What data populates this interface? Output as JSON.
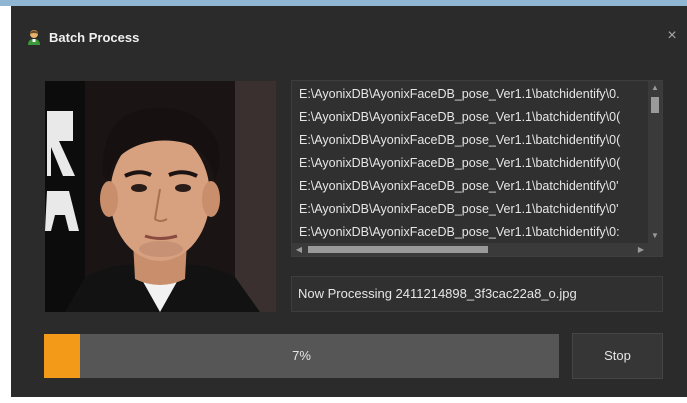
{
  "window": {
    "title": "Batch Process",
    "close_glyph": "×",
    "icon": "user-icon"
  },
  "photo": {
    "description_icon": "face-photo"
  },
  "file_list": {
    "items": [
      "E:\\AyonixDB\\AyonixFaceDB_pose_Ver1.1\\batchidentify\\0.",
      "E:\\AyonixDB\\AyonixFaceDB_pose_Ver1.1\\batchidentify\\0(",
      "E:\\AyonixDB\\AyonixFaceDB_pose_Ver1.1\\batchidentify\\0(",
      "E:\\AyonixDB\\AyonixFaceDB_pose_Ver1.1\\batchidentify\\0(",
      "E:\\AyonixDB\\AyonixFaceDB_pose_Ver1.1\\batchidentify\\0'",
      "E:\\AyonixDB\\AyonixFaceDB_pose_Ver1.1\\batchidentify\\0'",
      "E:\\AyonixDB\\AyonixFaceDB_pose_Ver1.1\\batchidentify\\0:"
    ]
  },
  "status": {
    "text": "Now Processing 2411214898_3f3cac22a8_o.jpg"
  },
  "progress": {
    "percent": 7,
    "label": "7%",
    "fill_color": "#f39a18"
  },
  "buttons": {
    "stop_label": "Stop"
  },
  "colors": {
    "window_bg": "#2b2b2b",
    "accent": "#f39a18"
  }
}
